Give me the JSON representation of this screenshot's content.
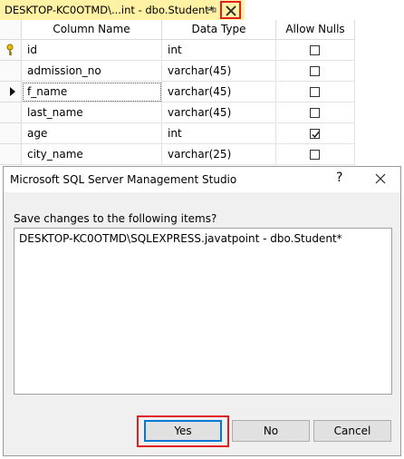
{
  "tab": {
    "title": "DESKTOP-KC0OTMD\\...int - dbo.Student*",
    "pin_icon": "pin-icon",
    "close_icon": "close-icon"
  },
  "grid": {
    "headers": [
      "Column Name",
      "Data Type",
      "Allow Nulls"
    ],
    "rows": [
      {
        "name": "id",
        "type": "int",
        "allow_nulls": false,
        "primary_key": true
      },
      {
        "name": "admission_no",
        "type": "varchar(45)",
        "allow_nulls": false
      },
      {
        "name": "f_name",
        "type": "varchar(45)",
        "allow_nulls": false,
        "current": true
      },
      {
        "name": "last_name",
        "type": "varchar(45)",
        "allow_nulls": false
      },
      {
        "name": "age",
        "type": "int",
        "allow_nulls": true
      },
      {
        "name": "city_name",
        "type": "varchar(25)",
        "allow_nulls": false
      }
    ]
  },
  "dialog": {
    "title": "Microsoft SQL Server Management Studio",
    "help": "?",
    "message": "Save changes to the following items?",
    "items": [
      "DESKTOP-KC0OTMD\\SQLEXPRESS.javatpoint - dbo.Student*"
    ],
    "buttons": {
      "yes": "Yes",
      "no": "No",
      "cancel": "Cancel"
    }
  },
  "colors": {
    "tab_bg": "#fff2a5",
    "highlight": "#e02020",
    "dialog_bg": "#f0f0f0",
    "focus": "#0078d7"
  }
}
